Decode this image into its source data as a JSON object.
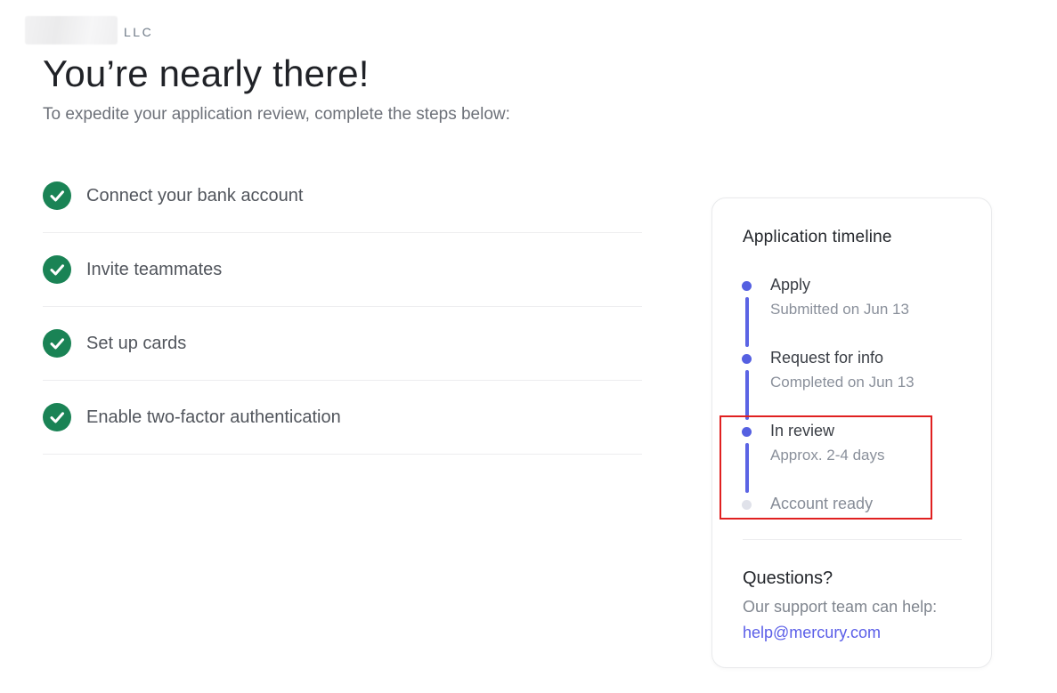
{
  "brand": {
    "llc_suffix": "LLC"
  },
  "header": {
    "title": "You’re nearly there!",
    "subtitle": "To expedite your application review, complete the steps below:"
  },
  "checklist": {
    "items": [
      {
        "label": "Connect your bank account",
        "status": "completed"
      },
      {
        "label": "Invite teammates",
        "status": "completed"
      },
      {
        "label": "Set up cards",
        "status": "completed"
      },
      {
        "label": "Enable two-factor authentication",
        "status": "completed"
      }
    ]
  },
  "timeline_card": {
    "title": "Application timeline",
    "steps": [
      {
        "label": "Apply",
        "sublabel": "Submitted on Jun 13",
        "state": "done"
      },
      {
        "label": "Request for info",
        "sublabel": "Completed on Jun 13",
        "state": "done"
      },
      {
        "label": "In review",
        "sublabel": "Approx. 2-4 days",
        "state": "active"
      },
      {
        "label": "Account ready",
        "sublabel": "",
        "state": "pending"
      }
    ],
    "questions": {
      "heading": "Questions?",
      "body": "Our support team can help:",
      "email": "help@mercury.com"
    }
  },
  "annotation": {
    "highlighted_steps": [
      "In review",
      "Account ready"
    ],
    "highlight_color": "#e02020"
  },
  "colors": {
    "check_green": "#1a8355",
    "timeline_indigo": "#5560e1",
    "pending_gray": "#e0e2ea",
    "link_indigo": "#5a5ee8",
    "heading_dark": "#202227",
    "body_gray": "#6d7179"
  }
}
